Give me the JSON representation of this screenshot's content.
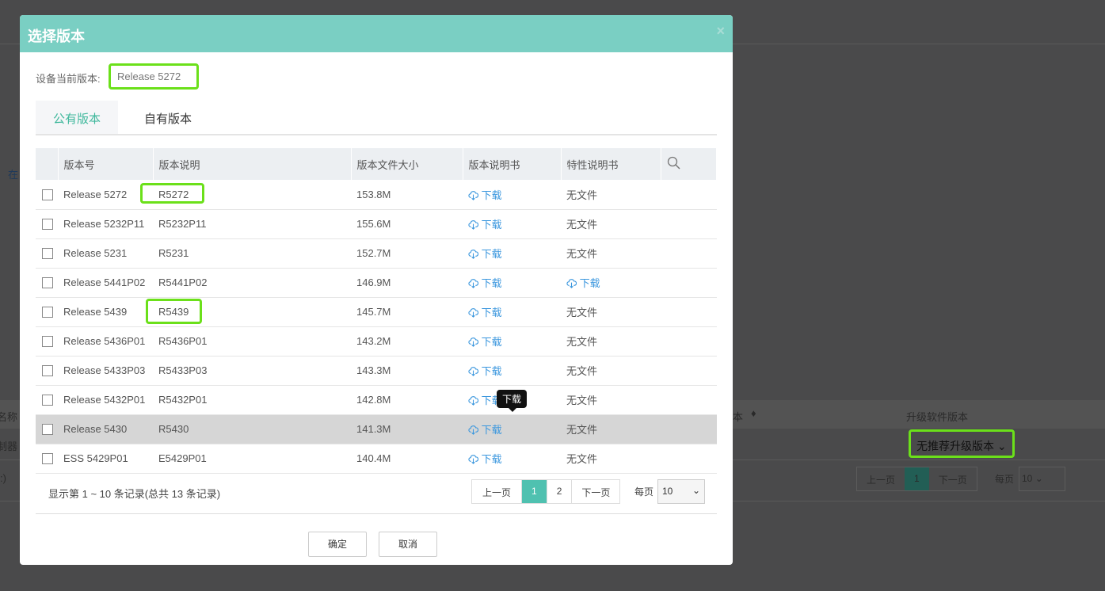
{
  "background": {
    "tab": "在",
    "col_name": "名称",
    "row_name": "制器",
    "footer": ":)",
    "col_version": "本",
    "col_upgrade": "升级软件版本",
    "upgrade_select": "无推荐升级版本",
    "prev": "上一页",
    "page": "1",
    "next": "下一页",
    "per_page_label": "每页",
    "per_page": "10"
  },
  "modal": {
    "title": "选择版本",
    "close": "×",
    "current_label": "设备当前版本:",
    "current_value": "Release 5272",
    "tabs": [
      {
        "label": "公有版本",
        "active": true
      },
      {
        "label": "自有版本",
        "active": false
      }
    ],
    "columns": [
      "版本号",
      "版本说明",
      "版本文件大小",
      "版本说明书",
      "特性说明书"
    ],
    "search_icon": "search-icon",
    "rows": [
      {
        "version": "Release 5272",
        "desc": "R5272",
        "size": "153.8M",
        "manual": "下载",
        "feature": "无文件"
      },
      {
        "version": "Release 5232P11",
        "desc": "R5232P11",
        "size": "155.6M",
        "manual": "下载",
        "feature": "无文件"
      },
      {
        "version": "Release 5231",
        "desc": "R5231",
        "size": "152.7M",
        "manual": "下载",
        "feature": "无文件"
      },
      {
        "version": "Release 5441P02",
        "desc": "R5441P02",
        "size": "146.9M",
        "manual": "下载",
        "feature": "下载"
      },
      {
        "version": "Release 5439",
        "desc": "R5439",
        "size": "145.7M",
        "manual": "下载",
        "feature": "无文件"
      },
      {
        "version": "Release 5436P01",
        "desc": "R5436P01",
        "size": "143.2M",
        "manual": "下载",
        "feature": "无文件"
      },
      {
        "version": "Release 5433P03",
        "desc": "R5433P03",
        "size": "143.3M",
        "manual": "下载",
        "feature": "无文件"
      },
      {
        "version": "Release 5432P01",
        "desc": "R5432P01",
        "size": "142.8M",
        "manual": "下载",
        "feature": "无文件"
      },
      {
        "version": "Release 5430",
        "desc": "R5430",
        "size": "141.3M",
        "manual": "下载",
        "feature": "无文件"
      },
      {
        "version": "ESS 5429P01",
        "desc": "E5429P01",
        "size": "140.4M",
        "manual": "下载",
        "feature": "无文件"
      }
    ],
    "tooltip": "下载",
    "summary": "显示第 1 ~ 10 条记录(总共 13 条记录)",
    "pager": {
      "prev": "上一页",
      "pages": [
        "1",
        "2"
      ],
      "current": "1",
      "next": "下一页",
      "per_page_label": "每页",
      "per_page": "10"
    },
    "ok": "确定",
    "cancel": "取消",
    "colors": {
      "header": "#7acfc3",
      "accent": "#4fc1b0",
      "highlight": "#6be01a",
      "link": "#3b97de"
    }
  }
}
